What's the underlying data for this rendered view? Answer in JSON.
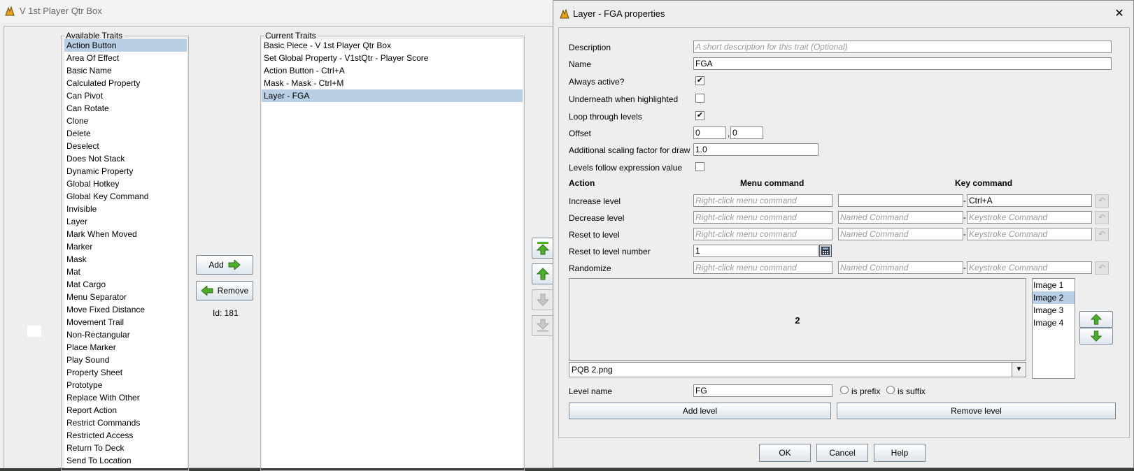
{
  "bg_window": {
    "title": "V 1st Player Qtr Box",
    "available_traits": {
      "legend": "Available Traits",
      "items": [
        "Action Button",
        "Area Of Effect",
        "Basic Name",
        "Calculated Property",
        "Can Pivot",
        "Can Rotate",
        "Clone",
        "Delete",
        "Deselect",
        "Does Not Stack",
        "Dynamic Property",
        "Global Hotkey",
        "Global Key Command",
        "Invisible",
        "Layer",
        "Mark When Moved",
        "Marker",
        "Mask",
        "Mat",
        "Mat Cargo",
        "Menu Separator",
        "Move Fixed Distance",
        "Movement Trail",
        "Non-Rectangular",
        "Place Marker",
        "Play Sound",
        "Property Sheet",
        "Prototype",
        "Replace With Other",
        "Report Action",
        "Restrict Commands",
        "Restricted Access",
        "Return To Deck",
        "Send To Location"
      ],
      "selected": "Action Button"
    },
    "add_label": "Add",
    "remove_label": "Remove",
    "id_label": "Id: 181",
    "current_traits": {
      "legend": "Current Traits",
      "items": [
        "Basic Piece - V 1st Player Qtr Box",
        "Set Global Property - V1stQtr - Player Score",
        "Action Button - Ctrl+A",
        "Mask - Mask - Ctrl+M",
        "Layer - FGA"
      ],
      "selected": "Layer - FGA"
    }
  },
  "dialog": {
    "title": "Layer - FGA properties",
    "close": "✕",
    "description_label": "Description",
    "description_placeholder": "A short description for this trait (Optional)",
    "name_label": "Name",
    "name_value": "FGA",
    "always_active_label": "Always active?",
    "always_active": true,
    "underneath_label": "Underneath when highlighted",
    "underneath": false,
    "loop_label": "Loop through levels",
    "loop": true,
    "offset_label": "Offset",
    "offset_x": "0",
    "offset_sep": ",",
    "offset_y": "0",
    "scaling_label": "Additional scaling factor for draw",
    "scaling_value": "1.0",
    "follow_label": "Levels follow expression value",
    "follow": false,
    "col_action": "Action",
    "col_menu": "Menu command",
    "col_key": "Key command",
    "menu_placeholder": "Right-click menu command",
    "named_placeholder": "Named Command",
    "keystroke_placeholder": "Keystroke Command",
    "dash": "-",
    "undo_icon": "↶",
    "increase_label": "Increase level",
    "increase_named": "",
    "increase_key": "Ctrl+A",
    "decrease_label": "Decrease level",
    "reset_label": "Reset to level",
    "reset_number_label": "Reset to level number",
    "reset_number_value": "1",
    "randomize_label": "Randomize",
    "preview_text": "2",
    "image_file": "PQB 2.png",
    "images": [
      "Image 1",
      "Image 2",
      "Image 3",
      "Image 4"
    ],
    "selected_image": "Image 2",
    "level_name_label": "Level name",
    "level_name_value": "FG",
    "prefix_label": "is prefix",
    "suffix_label": "is suffix",
    "add_level": "Add level",
    "remove_level": "Remove level",
    "ok": "OK",
    "cancel": "Cancel",
    "help": "Help"
  },
  "colors": {
    "selection": "#b8cfe5",
    "green_arrow": "#4caf2a",
    "window_bg": "#eeeeee"
  },
  "icons": [
    "app-icon",
    "green-right-arrow-icon",
    "green-left-arrow-icon",
    "move-top-icon",
    "move-up-icon",
    "move-down-icon",
    "move-bottom-icon",
    "calculator-icon",
    "undo-icon",
    "chevron-down-icon"
  ]
}
